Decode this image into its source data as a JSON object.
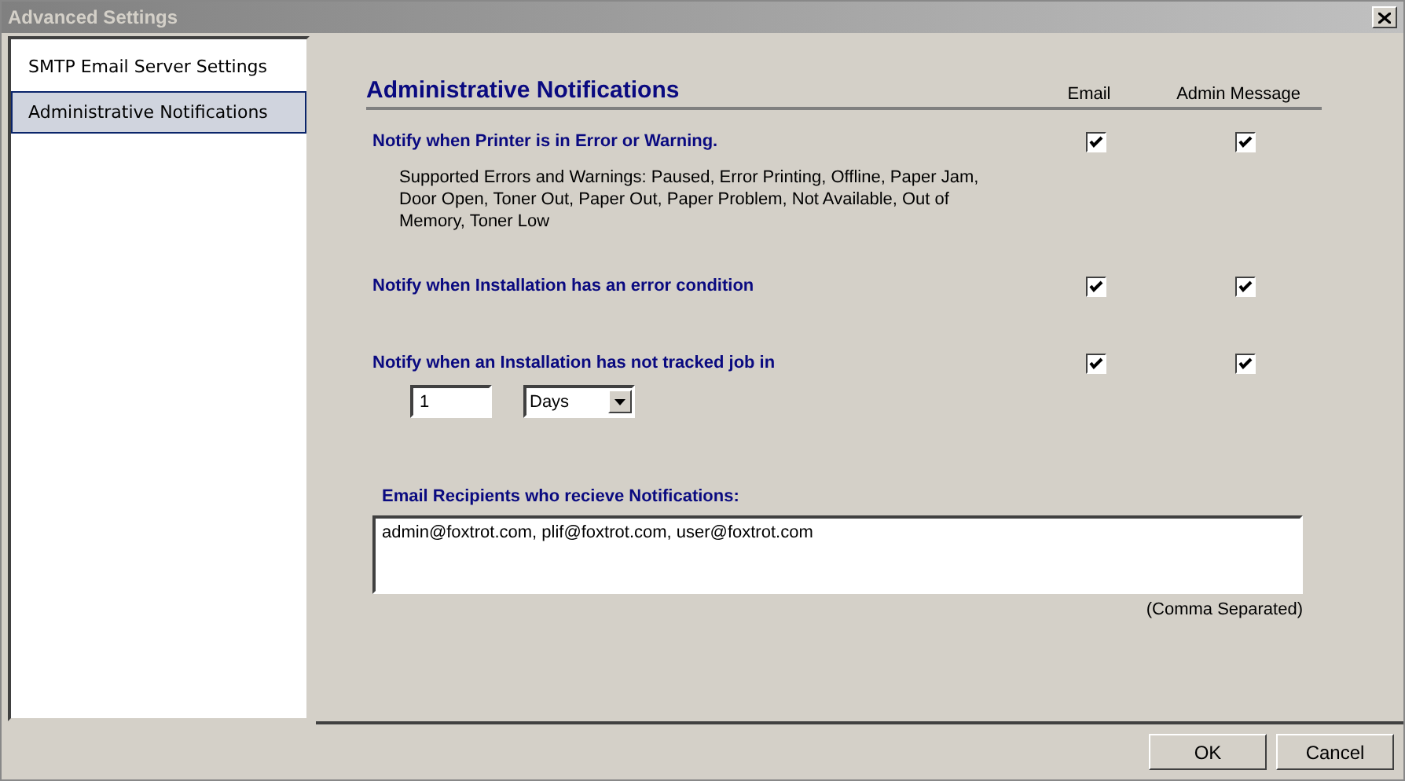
{
  "window": {
    "title": "Advanced Settings"
  },
  "sidebar": {
    "items": [
      {
        "label": "SMTP Email Server Settings",
        "selected": false
      },
      {
        "label": "Administrative Notifications",
        "selected": true
      }
    ]
  },
  "section": {
    "title": "Administrative Notifications",
    "columns": [
      "Email",
      "Admin Message"
    ]
  },
  "notifications": [
    {
      "label": "Notify when Printer is in Error or Warning.",
      "description": "Supported Errors and Warnings: Paused, Error Printing, Offline, Paper Jam, Door Open, Toner Out, Paper Out, Paper Problem, Not Available, Out of Memory, Toner Low",
      "email": true,
      "admin_message": true
    },
    {
      "label": "Notify when Installation has an error condition",
      "email": true,
      "admin_message": true
    },
    {
      "label": "Notify when an Installation has not tracked job in",
      "email": true,
      "admin_message": true,
      "threshold": {
        "value": "1",
        "unit": "Days"
      }
    }
  ],
  "recipients": {
    "label": "Email Recipients who recieve Notifications:",
    "value": "admin@foxtrot.com, plif@foxtrot.com, user@foxtrot.com",
    "hint": "(Comma Separated)"
  },
  "buttons": [
    "OK",
    "Cancel"
  ]
}
